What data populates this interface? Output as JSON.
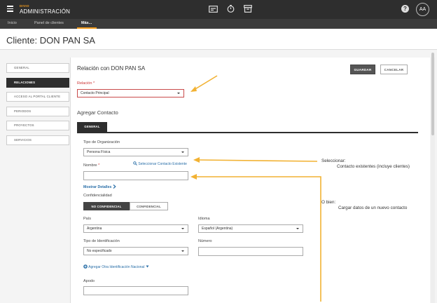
{
  "app": {
    "brand_small": "DIVIO",
    "brand_main": "ADMINISTRACIÓN",
    "help_symbol": "?",
    "avatar_initials": "AA"
  },
  "nav": {
    "items": [
      {
        "label": "Inicio"
      },
      {
        "label": "Panel de clientes"
      },
      {
        "label": "Más..."
      }
    ]
  },
  "page": {
    "title": "Cliente: DON PAN SA"
  },
  "sidebar": {
    "items": [
      {
        "label": "GENERAL"
      },
      {
        "label": "RELACIONES"
      },
      {
        "label": "ACCESO AL PORTAL CLIENTE"
      },
      {
        "label": "PERIODOS"
      },
      {
        "label": "PROYECTOS"
      },
      {
        "label": "SERVICIOS"
      }
    ],
    "active_index": 1
  },
  "form": {
    "title": "Relación con DON PAN SA",
    "save_label": "GUARDAR",
    "cancel_label": "CANCELAR",
    "relacion_label": "Relación",
    "relacion_required": "*",
    "relacion_value": "Contacto Principal",
    "agregar_contacto": "Agregar Contacto",
    "tab_general": "GENERAL",
    "tipo_org_label": "Tipo de Organización",
    "tipo_org_value": "Persona Física",
    "nombre_label": "Nombre",
    "nombre_required": "*",
    "seleccionar_contacto": "Seleccionar Contacto Existente",
    "mostrar_detalles": "Mostrar Detalles",
    "confidencialidad_label": "Confidencialidad",
    "no_confidencial": "NO CONFIDENCIAL",
    "confidencial": "CONFIDENCIAL",
    "pais_label": "País",
    "pais_value": "Argentina",
    "idioma_label": "Idioma",
    "idioma_value": "Español (Argentina)",
    "tipo_id_label": "Tipo de Identificación",
    "tipo_id_value": "No especificado",
    "numero_label": "Número",
    "agregar_id": "Agregar Otra Identificación Nacional",
    "apodo_label": "Apodo"
  },
  "annotations": {
    "seleccionar_title": "Seleccionar:",
    "seleccionar_desc": "Contacto existentes (incluye clientes)",
    "obien_title": "O bien:",
    "obien_desc": "Cargar datos de un nuevo contacto"
  },
  "colors": {
    "accent": "#f29b1d",
    "topbar": "#2e2e2e",
    "link": "#2a6fa8",
    "required": "#cc3333"
  }
}
